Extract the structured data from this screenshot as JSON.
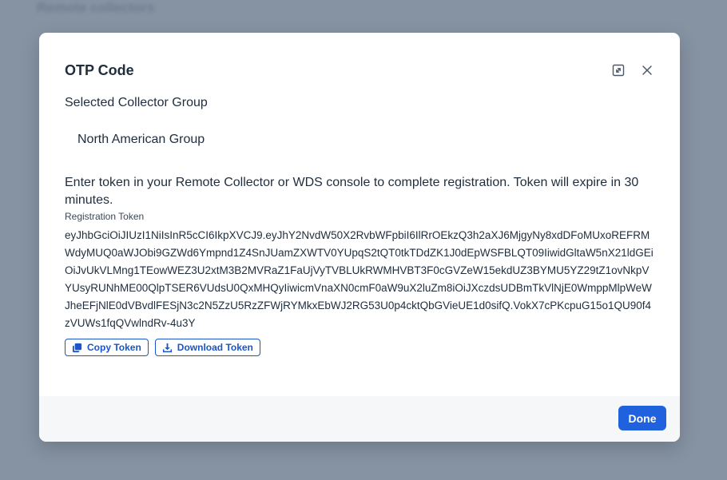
{
  "background": {
    "page_title": "Remote collectors"
  },
  "modal": {
    "title": "OTP Code",
    "selected_group_label": "Selected Collector Group",
    "selected_group_value": "North American Group",
    "instructions": "Enter token in your Remote Collector or WDS console to complete registration. Token will expire in 30 minutes.",
    "token_label": "Registration Token",
    "token_value": "eyJhbGciOiJIUzI1NiIsInR5cCI6IkpXVCJ9.eyJhY2NvdW50X2RvbWFpbiI6IlRrOEkzQ3h2aXJ6MjgyNy8xdDFoMUxoREFRMWdyMUQ0aWJObi9GZWd6Ympnd1Z4SnJUamZXWTV0YUpqS2tQT0tkTDdZK1J0dEpWSFBLQT09IiwidGltaW5nX21ldGEiOiJvUkVLMng1TEowWEZ3U2xtM3B2MVRaZ1FaUjVyTVBLUkRWMHVBT3F0cGVZeW15ekdUZ3BYMU5YZ29tZ1ovNkpVYUsyRUNhME00QlpTSER6VUdsU0QxMHQyIiwicmVnaXN0cmF0aW9uX2luZm8iOiJXczdsUDBmTkVlNjE0WmppMlpWeWJheEFjNlE0dVBvdlFESjN3c2N5ZzU5RzZFWjRYMkxEbWJ2RG53U0p4cktQbGVieUE1d0sifQ.VokX7cPKcpuG15o1QU90f4zVUWs1fqQVwlndRv-4u3Y",
    "copy_button_label": "Copy Token",
    "download_button_label": "Download Token",
    "done_button_label": "Done"
  },
  "icons": {
    "expand": "expand-icon",
    "close": "close-icon",
    "copy": "copy-icon",
    "download": "download-icon"
  },
  "colors": {
    "primary": "#2062dd",
    "outline": "#1a56c7",
    "text": "#1f2d3d",
    "backdrop": "#8693a3"
  }
}
